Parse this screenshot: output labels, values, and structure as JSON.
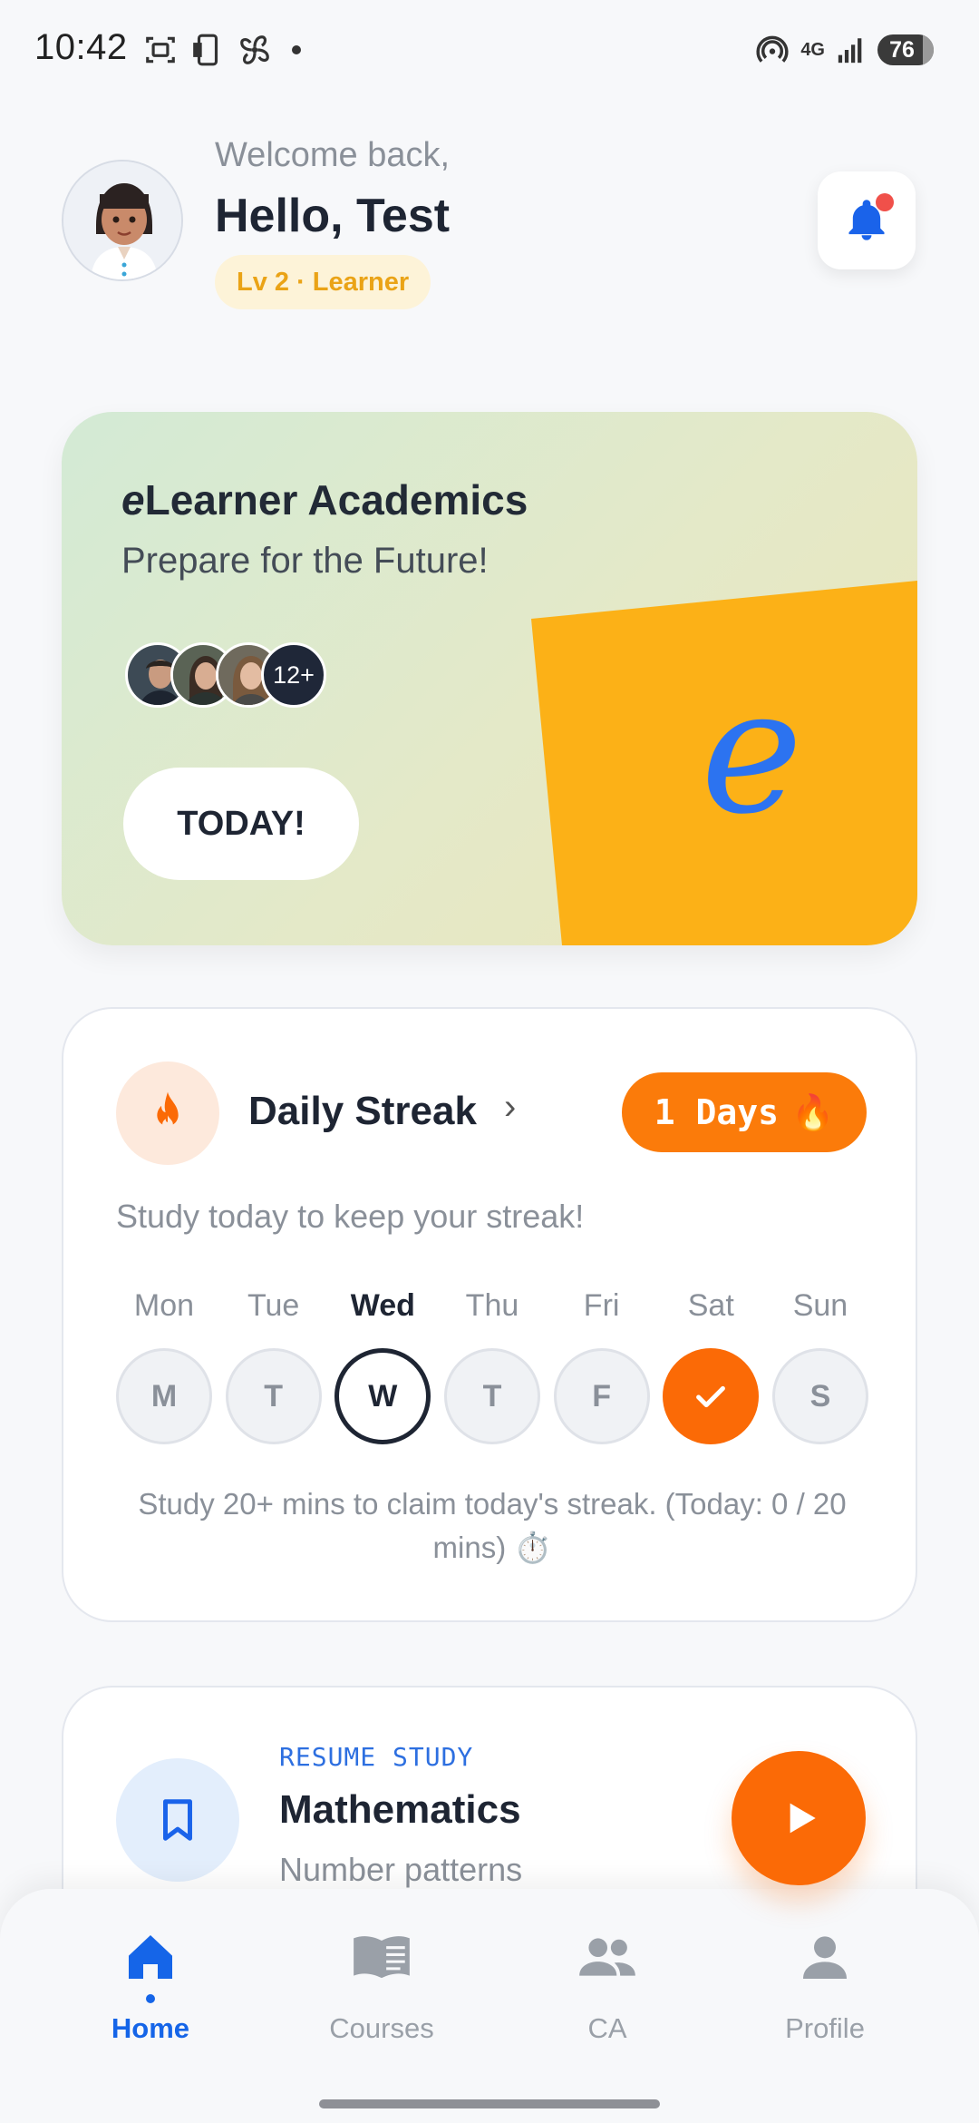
{
  "status_bar": {
    "time": "10:42",
    "battery": "76",
    "network": "4G"
  },
  "header": {
    "welcome": "Welcome back,",
    "greeting": "Hello, Test",
    "level_badge": "Lv 2 · Learner",
    "notification_unread": true
  },
  "hero": {
    "title_prefix": "e",
    "title_rest": "Learner Academics",
    "subtitle": "Prepare for the Future!",
    "more_count": "12+",
    "button_label": "TODAY!",
    "logo_letter": "e",
    "colors": {
      "accent": "#fcb117",
      "logo": "#2c73f0"
    }
  },
  "streak": {
    "title": "Daily Streak",
    "days_label": "1 Days",
    "days_emoji": "🔥",
    "hint": "Study today to keep your streak!",
    "week": [
      {
        "label": "Mon",
        "letter": "M",
        "state": "empty"
      },
      {
        "label": "Tue",
        "letter": "T",
        "state": "empty"
      },
      {
        "label": "Wed",
        "letter": "W",
        "state": "today"
      },
      {
        "label": "Thu",
        "letter": "T",
        "state": "empty"
      },
      {
        "label": "Fri",
        "letter": "F",
        "state": "empty"
      },
      {
        "label": "Sat",
        "letter": "",
        "state": "done"
      },
      {
        "label": "Sun",
        "letter": "S",
        "state": "empty"
      }
    ],
    "note": "Study 20+ mins to claim today's streak. (Today: 0 / 20 mins) ⏱️",
    "colors": {
      "accent": "#fb6a06"
    }
  },
  "resume": {
    "label": "RESUME STUDY",
    "subject": "Mathematics",
    "topic": "Number patterns"
  },
  "nav": {
    "items": [
      {
        "label": "Home",
        "icon": "home-icon",
        "active": true
      },
      {
        "label": "Courses",
        "icon": "book-icon",
        "active": false
      },
      {
        "label": "CA",
        "icon": "group-icon",
        "active": false
      },
      {
        "label": "Profile",
        "icon": "person-icon",
        "active": false
      }
    ],
    "colors": {
      "active": "#1565e8",
      "inactive": "#9aa0a8"
    }
  }
}
